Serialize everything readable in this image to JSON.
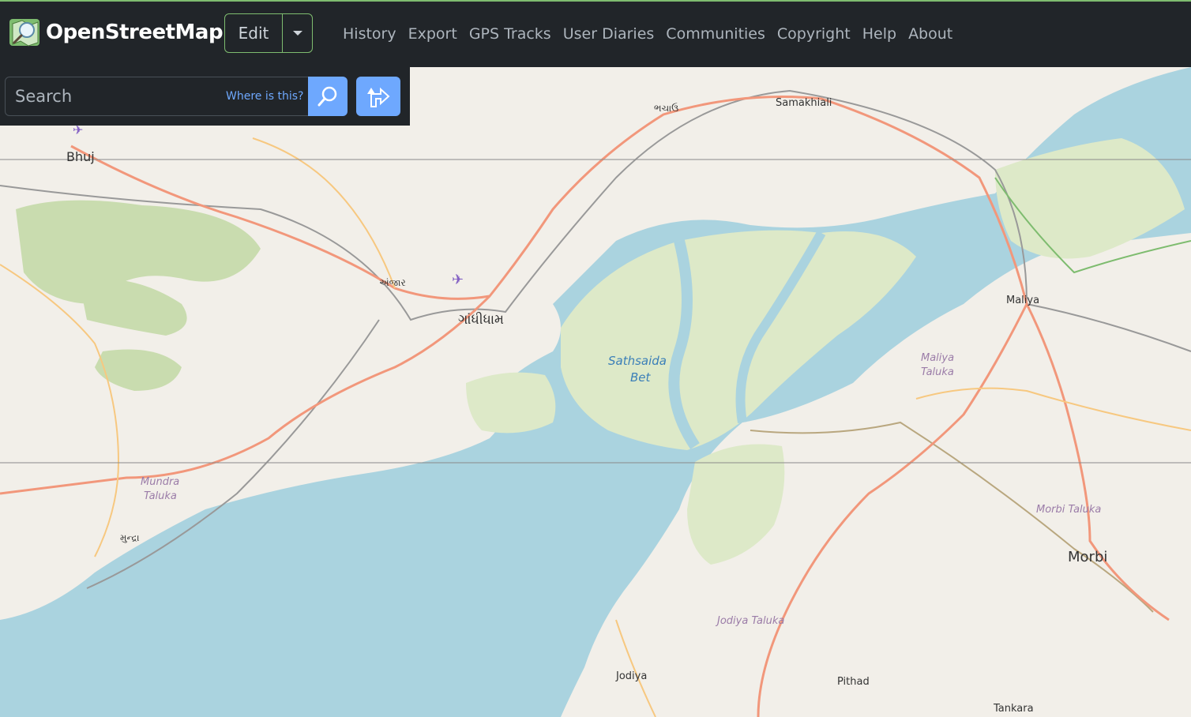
{
  "header": {
    "brand": "OpenStreetMap",
    "edit_label": "Edit",
    "nav": [
      "History",
      "Export",
      "GPS Tracks",
      "User Diaries",
      "Communities",
      "Copyright",
      "Help",
      "About"
    ]
  },
  "search": {
    "placeholder": "Search",
    "where_link": "Where is this?",
    "search_icon": "magnifier-icon",
    "directions_icon": "directions-icon"
  },
  "map": {
    "places": {
      "bhuj": "Bhuj",
      "anjar": "અંજાર",
      "gandhidham": "ગાંધીધામ",
      "bhachau": "ભચાઉ",
      "samakhiali": "Samakhiali",
      "maliya": "Maliya",
      "maliya_taluka_1": "Maliya",
      "maliya_taluka_2": "Taluka",
      "sathsaida_1": "Sathsaida",
      "sathsaida_2": "Bet",
      "mundra_taluka_1": "Mundra",
      "mundra_taluka_2": "Taluka",
      "mundra": "મુન્દ્રા",
      "morbi_taluka": "Morbi Taluka",
      "morbi": "Morbi",
      "jodiya_taluka": "Jodiya Taluka",
      "jodiya": "Jodiya",
      "pithad": "Pithad",
      "tankara": "Tankara"
    },
    "colors": {
      "land": "#f2efe9",
      "water": "#aad3df",
      "wetland": "#dde9c8",
      "primary_road": "#f2977b",
      "secondary_road": "#f7c880",
      "railway": "#999999",
      "park": "#add19e",
      "boundary": "#c9a0c9"
    }
  }
}
